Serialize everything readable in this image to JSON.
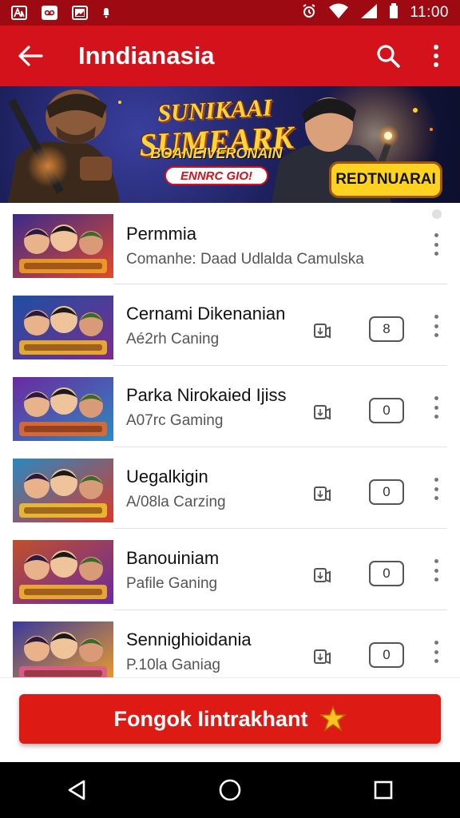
{
  "status_bar": {
    "time": "11:00",
    "left_icons": [
      "app-notification-icon",
      "voicemail-icon",
      "image-icon",
      "bell-icon"
    ],
    "right_icons": [
      "alarm-icon",
      "wifi-icon",
      "signal-icon",
      "battery-icon"
    ]
  },
  "app_bar": {
    "title": "Inndianasia",
    "back_icon": "arrow-left-icon",
    "search_icon": "search-icon",
    "menu_icon": "more-vert-icon"
  },
  "banner": {
    "title_line1": "SUNIKAAI",
    "title_line2": "SUMEARK",
    "subtitle": "BOANEIVERONAIN",
    "tag": "ENNRC GIO!",
    "button": "REDTNUARAI"
  },
  "list": [
    {
      "title": "Permmia",
      "subtitle": "Comanhe: Daad Udlalda Camulska",
      "show_actions": false,
      "badge": ""
    },
    {
      "title": "Cernami Dikenanian",
      "subtitle": "Aé2rh Caning",
      "show_actions": true,
      "badge": "8"
    },
    {
      "title": "Parka Nirokaied Ijiss",
      "subtitle": "A07rc Gaming",
      "show_actions": true,
      "badge": "0"
    },
    {
      "title": "Uegalkigin",
      "subtitle": "A/08la Carzing",
      "show_actions": true,
      "badge": "0"
    },
    {
      "title": "Banouiniam",
      "subtitle": "Pafile Ganing",
      "show_actions": true,
      "badge": "0"
    },
    {
      "title": "Sennighioidania",
      "subtitle": "P.10la Ganiag",
      "show_actions": true,
      "badge": "0"
    }
  ],
  "bottom_button": {
    "label": "Fongok Iintrakhant",
    "icon": "sparkle-icon"
  },
  "nav_bar": {
    "back": "nav-back-icon",
    "home": "nav-home-icon",
    "recents": "nav-recents-icon"
  },
  "colors": {
    "primary": "#d3121b",
    "status_bar": "#9e0a12",
    "cta": "#de1a14",
    "banner_gold": "#ffd21f"
  }
}
